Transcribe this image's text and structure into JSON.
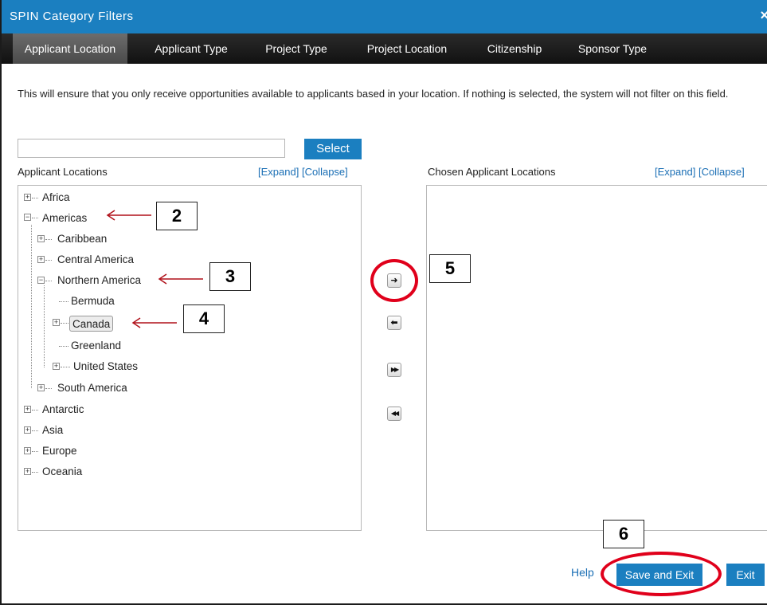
{
  "window": {
    "title": "SPIN Category Filters",
    "close_glyph": "×"
  },
  "tabs": [
    {
      "label": "Applicant Location",
      "active": true
    },
    {
      "label": "Applicant Type",
      "active": false
    },
    {
      "label": "Project Type",
      "active": false
    },
    {
      "label": "Project Location",
      "active": false
    },
    {
      "label": "Citizenship",
      "active": false
    },
    {
      "label": "Sponsor Type",
      "active": false
    }
  ],
  "intro": "This will ensure that you only receive opportunities available to applicants based in your location. If nothing is selected, the system will not filter on this field.",
  "search": {
    "value": "",
    "placeholder": "",
    "select_label": "Select"
  },
  "left_panel": {
    "title": "Applicant Locations",
    "expand": "[Expand]",
    "collapse": "[Collapse]"
  },
  "right_panel": {
    "title": "Chosen Applicant Locations",
    "expand": "[Expand]",
    "collapse": "[Collapse]"
  },
  "tree": {
    "africa": "Africa",
    "americas": "Americas",
    "caribbean": "Caribbean",
    "central_america": "Central America",
    "northern_america": "Northern America",
    "bermuda": "Bermuda",
    "canada": "Canada",
    "greenland": "Greenland",
    "united_states": "United States",
    "south_america": "South America",
    "antarctic": "Antarctic",
    "asia": "Asia",
    "europe": "Europe",
    "oceania": "Oceania"
  },
  "move_buttons": {
    "add": "➜",
    "remove": "⬅",
    "add_all": "▶▶",
    "remove_all": "◀◀"
  },
  "footer": {
    "help": "Help",
    "save_exit": "Save and Exit",
    "exit": "Exit"
  },
  "annotations": {
    "c2": "2",
    "c3": "3",
    "c4": "4",
    "c5": "5",
    "c6": "6"
  },
  "colors": {
    "accent": "#1b7fc0",
    "annotation_red": "#e0001b",
    "arrow_red": "#b0111a"
  }
}
